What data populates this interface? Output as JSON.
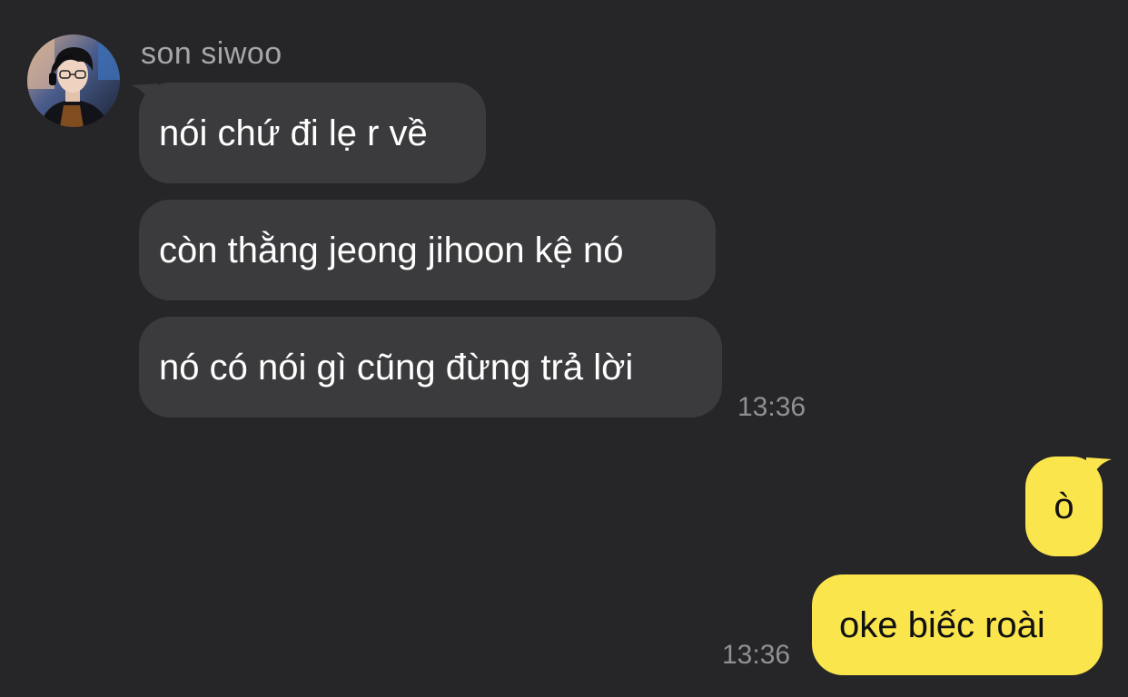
{
  "chat": {
    "sender_name": "son siwoo",
    "incoming": [
      {
        "text": "nói chứ đi lẹ r về"
      },
      {
        "text": "còn thằng jeong jihoon kệ nó"
      },
      {
        "text": "nó có nói gì cũng đừng trả lời"
      }
    ],
    "incoming_time": "13:36",
    "outgoing": [
      {
        "text": "ò"
      },
      {
        "text": "oke biếc roài"
      }
    ],
    "outgoing_time": "13:36"
  },
  "colors": {
    "background": "#262628",
    "incoming_bubble": "#3b3b3d",
    "outgoing_bubble": "#fbe54d"
  }
}
